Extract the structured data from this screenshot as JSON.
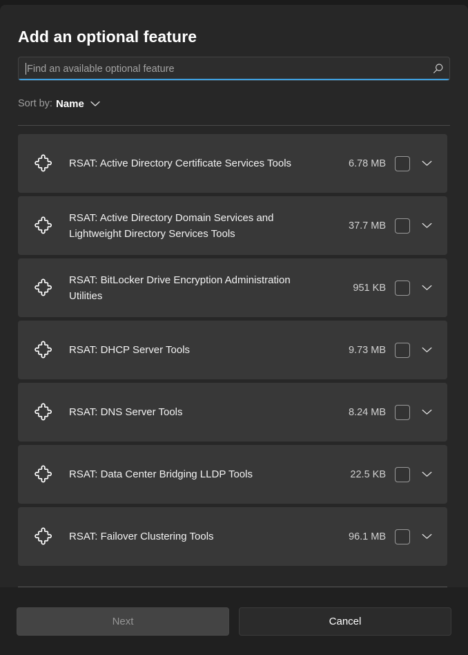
{
  "dialog": {
    "title": "Add an optional feature"
  },
  "search": {
    "placeholder": "Find an available optional feature",
    "value": "",
    "icon": "search-icon"
  },
  "sort": {
    "label": "Sort by:",
    "value": "Name",
    "chevron_icon": "chevron-down-icon"
  },
  "list": {
    "item_icon": "puzzle-piece-icon",
    "expand_icon": "chevron-down-icon",
    "items": [
      {
        "name": "RSAT: Active Directory Certificate Services Tools",
        "size": "6.78 MB",
        "checked": false
      },
      {
        "name": "RSAT: Active Directory Domain Services and Lightweight Directory Services Tools",
        "size": "37.7 MB",
        "checked": false
      },
      {
        "name": "RSAT: BitLocker Drive Encryption Administration Utilities",
        "size": "951 KB",
        "checked": false
      },
      {
        "name": "RSAT: DHCP Server Tools",
        "size": "9.73 MB",
        "checked": false
      },
      {
        "name": "RSAT: DNS Server Tools",
        "size": "8.24 MB",
        "checked": false
      },
      {
        "name": "RSAT: Data Center Bridging LLDP Tools",
        "size": "22.5 KB",
        "checked": false
      },
      {
        "name": "RSAT: Failover Clustering Tools",
        "size": "96.1 MB",
        "checked": false
      }
    ]
  },
  "footer": {
    "next_label": "Next",
    "cancel_label": "Cancel",
    "next_disabled": true
  },
  "colors": {
    "accent": "#3fa0e0",
    "dialog_background": "#272727",
    "row_background": "#383838",
    "footer_background": "#202020",
    "text_primary": "#ffffff",
    "text_secondary": "#a3a3a3"
  }
}
